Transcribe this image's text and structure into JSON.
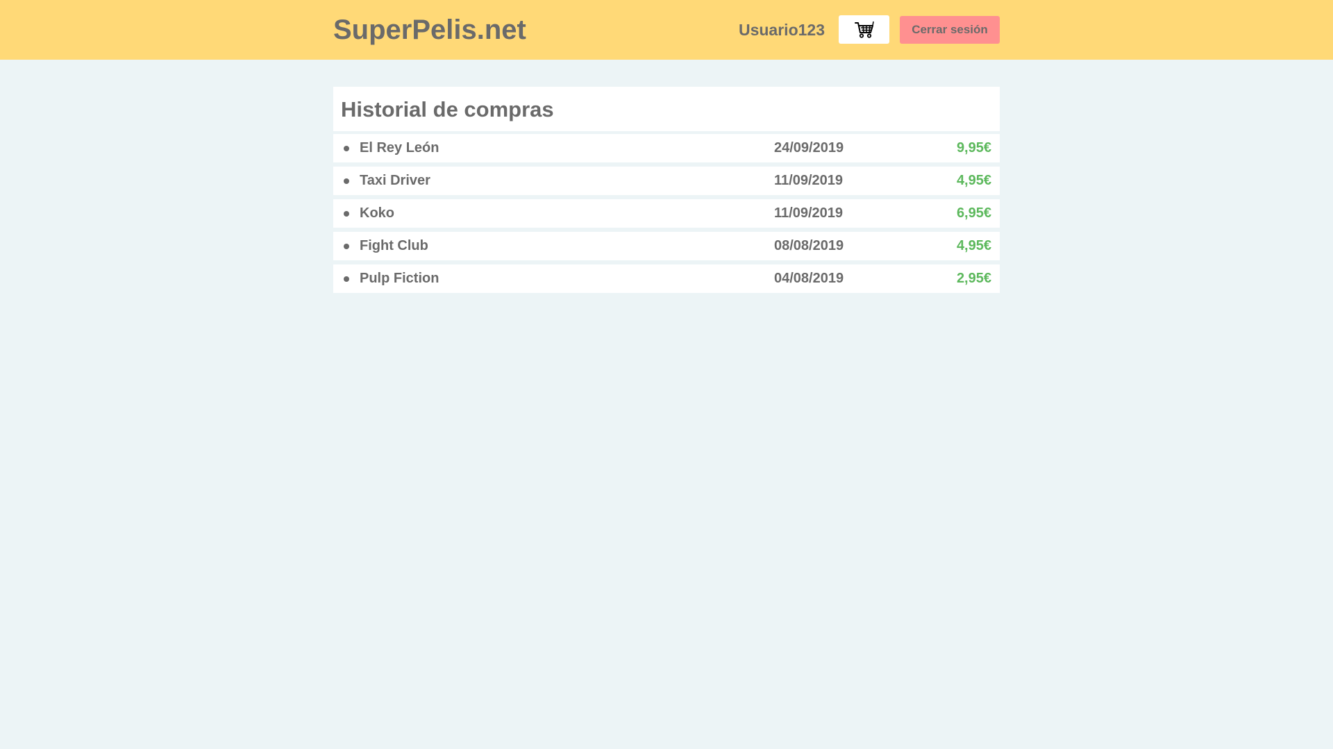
{
  "header": {
    "brand": "SuperPelis.net",
    "username": "Usuario123",
    "cart_icon": "shopping-cart-icon",
    "logout_label": "Cerrar sesión"
  },
  "history": {
    "title": "Historial de compras",
    "items": [
      {
        "title": "El Rey León",
        "date": "24/09/2019",
        "price": "9,95€"
      },
      {
        "title": "Taxi Driver",
        "date": "11/09/2019",
        "price": "4,95€"
      },
      {
        "title": "Koko",
        "date": "11/09/2019",
        "price": "6,95€"
      },
      {
        "title": "Fight Club",
        "date": "08/08/2019",
        "price": "4,95€"
      },
      {
        "title": "Pulp Fiction",
        "date": "04/08/2019",
        "price": "2,95€"
      }
    ]
  },
  "colors": {
    "header_bg": "#ffd977",
    "page_bg": "#ecf4f6",
    "logout_bg": "#ff9090",
    "price": "#5cb85c",
    "text": "#6a6a6a"
  }
}
